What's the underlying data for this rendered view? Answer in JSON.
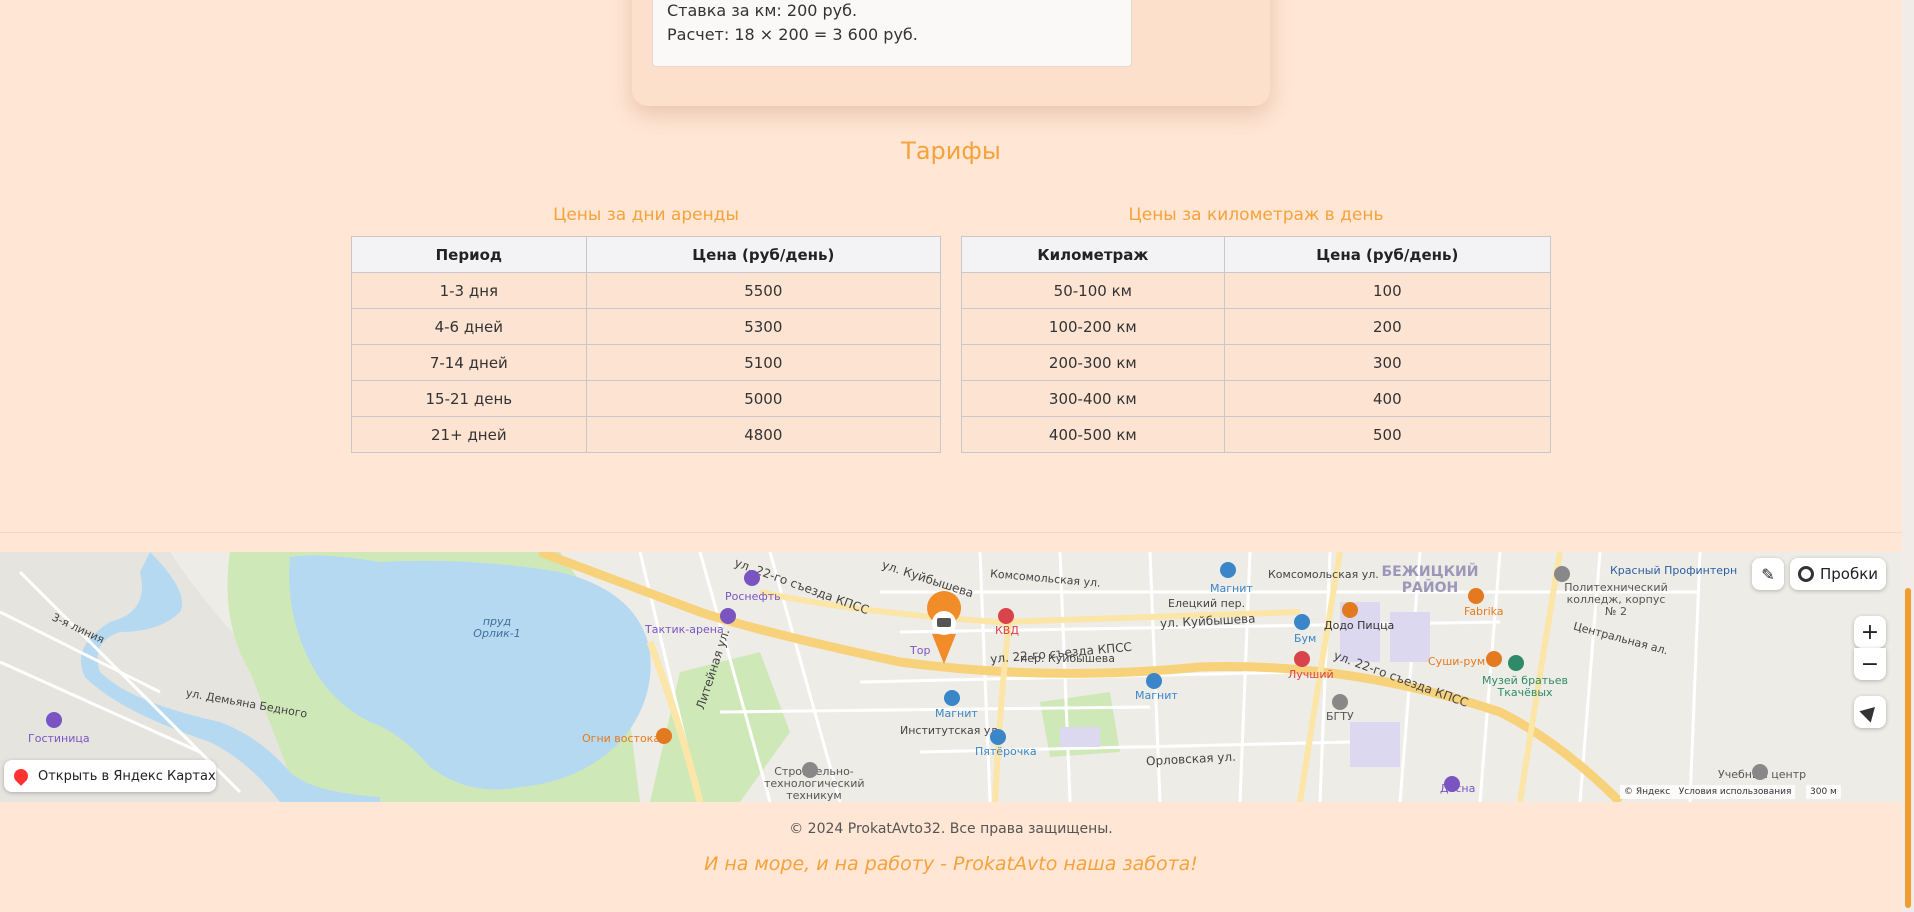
{
  "calculation": {
    "rate_line": "Ставка за км: 200 руб.",
    "calc_line": "Расчет: 18 × 200 = 3 600 руб."
  },
  "tariffs": {
    "title": "Тарифы",
    "days_table": {
      "caption": "Цены за дни аренды",
      "headers": [
        "Период",
        "Цена (руб/день)"
      ],
      "rows": [
        [
          "1-3 дня",
          "5500"
        ],
        [
          "4-6 дней",
          "5300"
        ],
        [
          "7-14 дней",
          "5100"
        ],
        [
          "15-21 день",
          "5000"
        ],
        [
          "21+ дней",
          "4800"
        ]
      ]
    },
    "km_table": {
      "caption": "Цены за километраж в день",
      "headers": [
        "Километраж",
        "Цена (руб/день)"
      ],
      "rows": [
        [
          "50-100 км",
          "100"
        ],
        [
          "100-200 км",
          "200"
        ],
        [
          "200-300 км",
          "300"
        ],
        [
          "300-400 км",
          "400"
        ],
        [
          "400-500 км",
          "500"
        ]
      ]
    }
  },
  "map": {
    "open_in_yandex": "Открыть в Яндекс Картах",
    "traffic_label": "Пробки",
    "zoom_in": "+",
    "zoom_out": "−",
    "copyright": "© Яндекс",
    "terms": "Условия использования",
    "scale": "300 м",
    "labels": {
      "pond": "пруд Орлик-1",
      "district": "БЕЖИЦКИЙ РАЙОН",
      "street_22": "ул. 22-го съезда КПСС",
      "street_kuib": "ул. Куйбышева",
      "street_orlov": "Орловская ул.",
      "street_institut": "Институтская ул.",
      "street_liteinaya": "Литейная ул.",
      "street_komsomol": "Комсомольская ул.",
      "street_eletsky": "Елецкий пер.",
      "street_kuib_per": "пер. Куйбышева",
      "street_tsentral": "Центральная ал.",
      "street_3line": "3-я линия",
      "street_bednogo": "ул. Демьяна Бедного"
    },
    "pois": {
      "rosneft": "Роснефть",
      "taktik": "Тактик-арена",
      "kvd": "КВД",
      "magnit1": "Магнит",
      "magnit2": "Магнит",
      "magnit3": "Магнит",
      "pyaterochka": "Пятёрочка",
      "ogni": "Огни востока",
      "gostinitsa": "Гостиница",
      "bum": "Бум",
      "dodo": "Додо Пицца",
      "luchshiy": "Лучший",
      "fabrika": "Fabrika",
      "sushi": "Суши-рум",
      "museum": "Музей братьев Ткачёвых",
      "college": "Политехнический колледж, корпус № 2",
      "bgtu": "БГТУ",
      "desna": "Десна",
      "uchebny": "Учебный центр",
      "krasny": "Красный Профинтерн",
      "stroitelny": "Строительно-технологический техникум",
      "tor": "Тор"
    },
    "colors": {
      "marker": "#f28c28",
      "water": "#b6d9f2",
      "park": "#cfe8b8",
      "road_main": "#f7d27a"
    }
  },
  "footer": {
    "copyright": "© 2024 ProkatAvto32. Все права защищены.",
    "slogan": "И на море, и на работу - ProkatAvto наша забота!"
  }
}
